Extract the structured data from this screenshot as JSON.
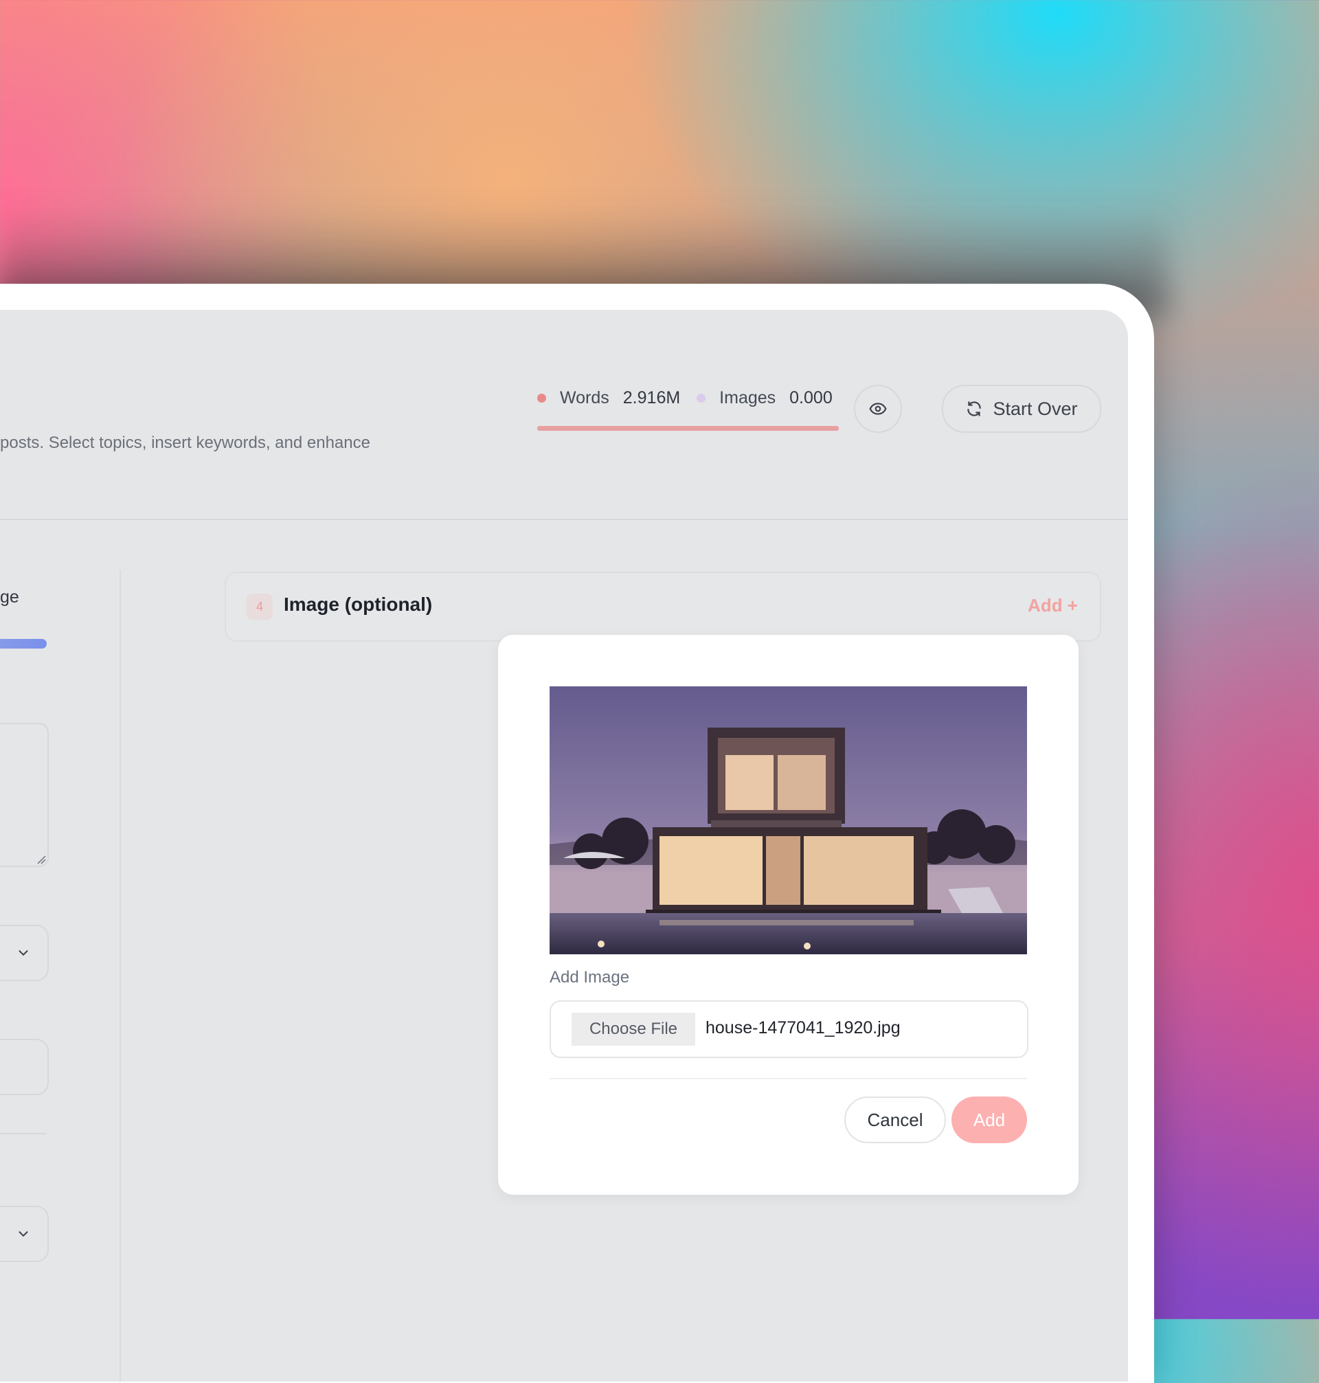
{
  "header": {
    "description": "posts. Select topics, insert keywords, and enhance",
    "stats": {
      "words_label": "Words",
      "words_value": "2.916M",
      "images_label": "Images",
      "images_value": "0.000",
      "usage_progress": 1.0
    },
    "start_over_label": "Start Over"
  },
  "left_panel": {
    "fragment_text": "ge"
  },
  "section": {
    "step_number": "4",
    "title": "Image (optional)",
    "add_label": "Add +"
  },
  "modal": {
    "label": "Add Image",
    "choose_file_label": "Choose File",
    "file_name": "house-1477041_1920.jpg",
    "cancel_label": "Cancel",
    "add_label": "Add"
  },
  "colors": {
    "words_dot": "#e88a8a",
    "images_dot": "#d8ccea",
    "accent": "#f3a2a0",
    "add_button": "#fdb0b0",
    "progress": "#8ea0ea"
  },
  "icons": {
    "preview": "eye-icon",
    "start_over": "refresh-icon",
    "dropdown": "chevron-down-icon"
  }
}
